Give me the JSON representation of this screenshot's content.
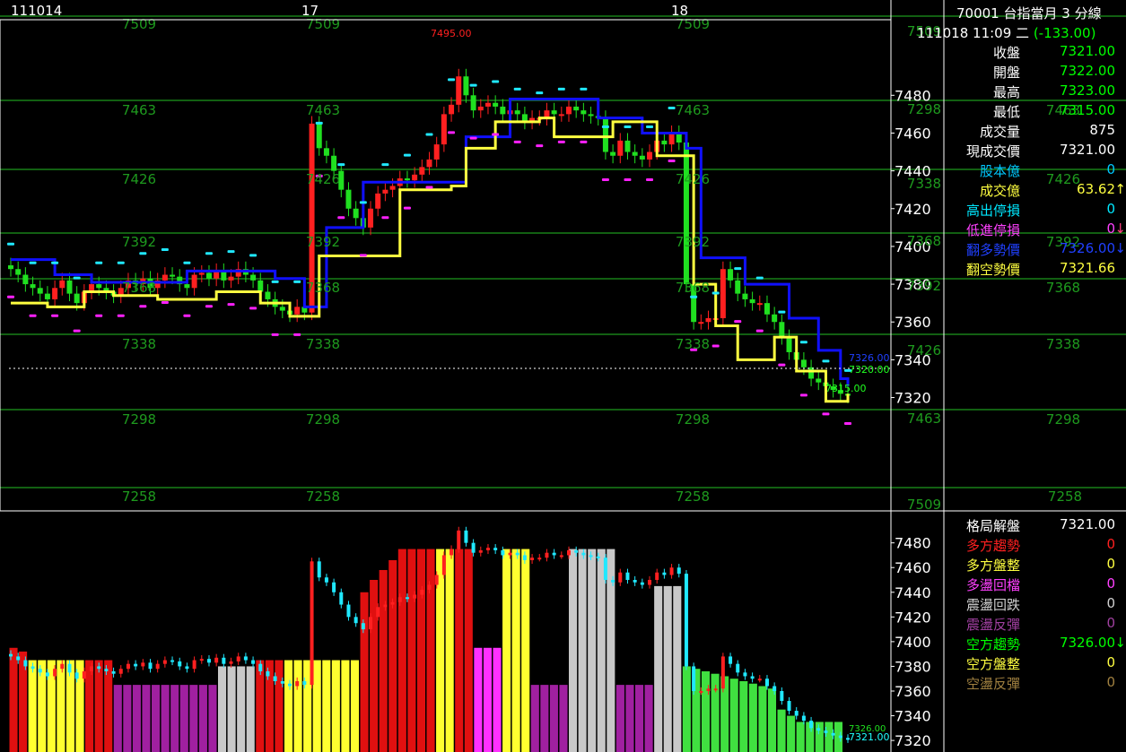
{
  "header": {
    "symbol_title": "70001  台指當月 3 分線",
    "datetime": "111018 11:09 二",
    "change": "(-133.00)"
  },
  "quote_rows": [
    {
      "label": "收盤",
      "value": "7321.00",
      "label_color": "#ffffff",
      "value_color": "#00ff00",
      "arrow": ""
    },
    {
      "label": "開盤",
      "value": "7322.00",
      "label_color": "#ffffff",
      "value_color": "#00ff00",
      "arrow": ""
    },
    {
      "label": "最高",
      "value": "7323.00",
      "label_color": "#ffffff",
      "value_color": "#00ff00",
      "arrow": ""
    },
    {
      "label": "最低",
      "value": "7315.00",
      "label_color": "#ffffff",
      "value_color": "#00ff00",
      "arrow": ""
    },
    {
      "label": "成交量",
      "value": "875",
      "label_color": "#ffffff",
      "value_color": "#ffffff",
      "arrow": ""
    },
    {
      "label": "現成交價",
      "value": "7321.00",
      "label_color": "#ffffff",
      "value_color": "#ffffff",
      "arrow": ""
    },
    {
      "label": "股本億",
      "value": "0",
      "label_color": "#00c8ff",
      "value_color": "#00c8ff",
      "arrow": ""
    },
    {
      "label": "成交億",
      "value": "63.62",
      "label_color": "#ffff40",
      "value_color": "#ffff40",
      "arrow": "↑",
      "arrow_color": "#ffff40"
    },
    {
      "label": "高出停損",
      "value": "0",
      "label_color": "#00e8ff",
      "value_color": "#00e8ff",
      "arrow": ""
    },
    {
      "label": "低進停損",
      "value": "0",
      "label_color": "#ff40ff",
      "value_color": "#ff40ff",
      "arrow": "↓",
      "arrow_color": "#ff4080"
    },
    {
      "label": "翻多勢價",
      "value": "7326.00",
      "label_color": "#2040ff",
      "value_color": "#2040ff",
      "arrow": "↓",
      "arrow_color": "#2040ff"
    },
    {
      "label": "翻空勢價",
      "value": "7321.66",
      "label_color": "#ffff40",
      "value_color": "#ffff40",
      "arrow": ""
    }
  ],
  "status_rows": [
    {
      "label": "格局解盤",
      "value": "7321.00",
      "label_color": "#ffffff",
      "value_color": "#ffffff",
      "arrow": ""
    },
    {
      "label": "多方趨勢",
      "value": "0",
      "label_color": "#ff2020",
      "value_color": "#ff2020",
      "arrow": ""
    },
    {
      "label": "多方盤整",
      "value": "0",
      "label_color": "#ffff40",
      "value_color": "#ffff40",
      "arrow": ""
    },
    {
      "label": "多盪回檔",
      "value": "0",
      "label_color": "#ff40ff",
      "value_color": "#ff40ff",
      "arrow": ""
    },
    {
      "label": "震盪回跌",
      "value": "0",
      "label_color": "#d0d0d0",
      "value_color": "#d0d0d0",
      "arrow": ""
    },
    {
      "label": "震盪反彈",
      "value": "0",
      "label_color": "#a040a0",
      "value_color": "#a040a0",
      "arrow": ""
    },
    {
      "label": "空方趨勢",
      "value": "7326.00",
      "label_color": "#00ff00",
      "value_color": "#00ff00",
      "arrow": "↓",
      "arrow_color": "#00ff00"
    },
    {
      "label": "空方盤整",
      "value": "0",
      "label_color": "#ffff40",
      "value_color": "#ffff40",
      "arrow": ""
    },
    {
      "label": "空盪反彈",
      "value": "0",
      "label_color": "#a08040",
      "value_color": "#a08040",
      "arrow": ""
    }
  ],
  "colors": {
    "up": "#ff2020",
    "down": "#20e020",
    "grid": "#1e9a1e",
    "level_text": "#1e9a1e",
    "blue_line": "#1010ff",
    "yellow_line": "#ffff40",
    "stop_cyan": "#20e8ff",
    "stop_magenta": "#ff20ff"
  },
  "chart_data": {
    "type": "candlestick",
    "date_labels": [
      "111014",
      "17",
      "18"
    ],
    "date_label_x_values": [
      0,
      42,
      93
    ],
    "upper_ylim": [
      7260,
      7520
    ],
    "upper_yticks": [
      7320,
      7340,
      7360,
      7380,
      7400,
      7420,
      7440,
      7460,
      7480
    ],
    "lower_ylim": [
      7315,
      7495
    ],
    "lower_yticks": [
      7320,
      7340,
      7360,
      7380,
      7400,
      7420,
      7440,
      7460,
      7480
    ],
    "level_lines": [
      7509,
      7463,
      7426,
      7392,
      7368,
      7338,
      7298,
      7258
    ],
    "level_label_columns": [
      [
        "7509",
        "7463",
        "7426",
        "7392",
        "7368",
        "7338",
        "7298",
        "7258"
      ],
      [
        "7509",
        "7463",
        "7426",
        "7392",
        "7368",
        "7338",
        "7298",
        "7258"
      ],
      [
        "7509",
        "7463",
        "7426",
        "7392",
        "7368",
        "7338",
        "7298",
        "7258"
      ]
    ],
    "right_levels": [
      "7509",
      "7298",
      "7338",
      "7368",
      "7392",
      "7426",
      "7463",
      "7509"
    ],
    "far_right_levels": [
      "7298",
      "7338",
      "7368",
      "7392",
      "7426",
      "7463",
      "7509"
    ],
    "annotations": {
      "high": "7495.00",
      "low": "7315.00",
      "last_green": "7320.00",
      "last_blue": "7326.00",
      "lower_last": "7321.00",
      "lower_last_blue": "7326.00"
    },
    "close_series": [
      7388,
      7385,
      7380,
      7378,
      7375,
      7372,
      7378,
      7382,
      7375,
      7370,
      7376,
      7380,
      7378,
      7376,
      7374,
      7378,
      7382,
      7380,
      7383,
      7378,
      7382,
      7385,
      7384,
      7380,
      7378,
      7385,
      7386,
      7383,
      7387,
      7382,
      7384,
      7388,
      7385,
      7382,
      7376,
      7372,
      7368,
      7366,
      7364,
      7368,
      7365,
      7465,
      7452,
      7448,
      7440,
      7430,
      7420,
      7415,
      7410,
      7420,
      7428,
      7430,
      7432,
      7436,
      7435,
      7438,
      7442,
      7446,
      7454,
      7470,
      7475,
      7490,
      7480,
      7472,
      7474,
      7476,
      7474,
      7470,
      7472,
      7470,
      7466,
      7468,
      7468,
      7472,
      7470,
      7470,
      7474,
      7472,
      7470,
      7469,
      7468,
      7450,
      7448,
      7456,
      7450,
      7448,
      7446,
      7450,
      7456,
      7454,
      7460,
      7455,
      7380,
      7360,
      7360,
      7362,
      7362,
      7388,
      7382,
      7375,
      7372,
      7370,
      7370,
      7364,
      7360,
      7352,
      7344,
      7340,
      7336,
      7330,
      7328,
      7326,
      7324,
      7322,
      7321
    ],
    "blue_line": [
      [
        0,
        7393
      ],
      [
        6,
        7385
      ],
      [
        11,
        7381
      ],
      [
        18,
        7381
      ],
      [
        24,
        7387
      ],
      [
        32,
        7387
      ],
      [
        36,
        7383
      ],
      [
        40,
        7368
      ],
      [
        41,
        7368
      ],
      [
        43,
        7410
      ],
      [
        48,
        7434
      ],
      [
        60,
        7434
      ],
      [
        62,
        7458
      ],
      [
        68,
        7478
      ],
      [
        75,
        7478
      ],
      [
        80,
        7468
      ],
      [
        86,
        7460
      ],
      [
        92,
        7452
      ],
      [
        94,
        7394
      ],
      [
        100,
        7380
      ],
      [
        106,
        7362
      ],
      [
        110,
        7345
      ],
      [
        113,
        7330
      ],
      [
        114,
        7326
      ]
    ],
    "yellow_line": [
      [
        0,
        7370
      ],
      [
        5,
        7368
      ],
      [
        10,
        7376
      ],
      [
        14,
        7374
      ],
      [
        20,
        7372
      ],
      [
        28,
        7376
      ],
      [
        34,
        7370
      ],
      [
        38,
        7363
      ],
      [
        41,
        7363
      ],
      [
        42,
        7395
      ],
      [
        52,
        7395
      ],
      [
        53,
        7430
      ],
      [
        60,
        7432
      ],
      [
        62,
        7452
      ],
      [
        66,
        7466
      ],
      [
        72,
        7468
      ],
      [
        74,
        7458
      ],
      [
        82,
        7466
      ],
      [
        88,
        7448
      ],
      [
        91,
        7448
      ],
      [
        93,
        7380
      ],
      [
        96,
        7358
      ],
      [
        99,
        7340
      ],
      [
        104,
        7352
      ],
      [
        107,
        7334
      ],
      [
        111,
        7318
      ],
      [
        114,
        7322
      ]
    ],
    "lower_state_colors": [
      "#e01010",
      "#e01010",
      "#ffff30",
      "#ffff30",
      "#ffff30",
      "#ffff30",
      "#ffff30",
      "#ffff30",
      "#e01010",
      "#e01010",
      "#e01010",
      "#a020a0",
      "#a020a0",
      "#a020a0",
      "#a020a0",
      "#a020a0",
      "#a020a0",
      "#a020a0",
      "#a020a0",
      "#a020a0",
      "#a020a0",
      "#a020a0",
      "#c8c8c8",
      "#c8c8c8",
      "#c8c8c8",
      "#c8c8c8",
      "#e01010",
      "#e01010",
      "#e01010",
      "#ffff30",
      "#ffff30",
      "#ffff30",
      "#ffff30",
      "#ffff30",
      "#ffff30",
      "#ffff30",
      "#ffff30",
      "#e01010",
      "#e01010",
      "#e01010",
      "#e01010",
      "#e01010",
      "#e01010",
      "#e01010",
      "#e01010",
      "#ffff30",
      "#ffff30",
      "#e01010",
      "#e01010",
      "#ff30ff",
      "#ff30ff",
      "#ff30ff",
      "#ffff30",
      "#ffff30",
      "#ffff30",
      "#a020a0",
      "#a020a0",
      "#a020a0",
      "#a020a0",
      "#c8c8c8",
      "#c8c8c8",
      "#c8c8c8",
      "#c8c8c8",
      "#c8c8c8",
      "#a020a0",
      "#a020a0",
      "#a020a0",
      "#a020a0",
      "#c8c8c8",
      "#c8c8c8",
      "#c8c8c8",
      "#40e040",
      "#40e040",
      "#40e040",
      "#40e040",
      "#40e040",
      "#40e040",
      "#40e040",
      "#40e040",
      "#40e040",
      "#40e040",
      "#40e040",
      "#40e040",
      "#40e040",
      "#40e040",
      "#40e040",
      "#40e040",
      "#40e040"
    ],
    "lower_state_levels": [
      7395,
      7392,
      7385,
      7385,
      7385,
      7385,
      7385,
      7385,
      7385,
      7385,
      7385,
      7365,
      7365,
      7365,
      7365,
      7365,
      7365,
      7365,
      7365,
      7365,
      7365,
      7365,
      7380,
      7380,
      7380,
      7380,
      7385,
      7385,
      7385,
      7385,
      7385,
      7385,
      7385,
      7385,
      7385,
      7385,
      7385,
      7440,
      7450,
      7458,
      7466,
      7475,
      7475,
      7475,
      7475,
      7475,
      7475,
      7475,
      7475,
      7395,
      7395,
      7395,
      7475,
      7475,
      7475,
      7365,
      7365,
      7365,
      7365,
      7475,
      7475,
      7475,
      7475,
      7475,
      7365,
      7365,
      7365,
      7365,
      7445,
      7445,
      7445,
      7380,
      7378,
      7376,
      7374,
      7372,
      7370,
      7368,
      7366,
      7364,
      7362,
      7345,
      7340,
      7335,
      7335,
      7335,
      7335,
      7335
    ]
  }
}
